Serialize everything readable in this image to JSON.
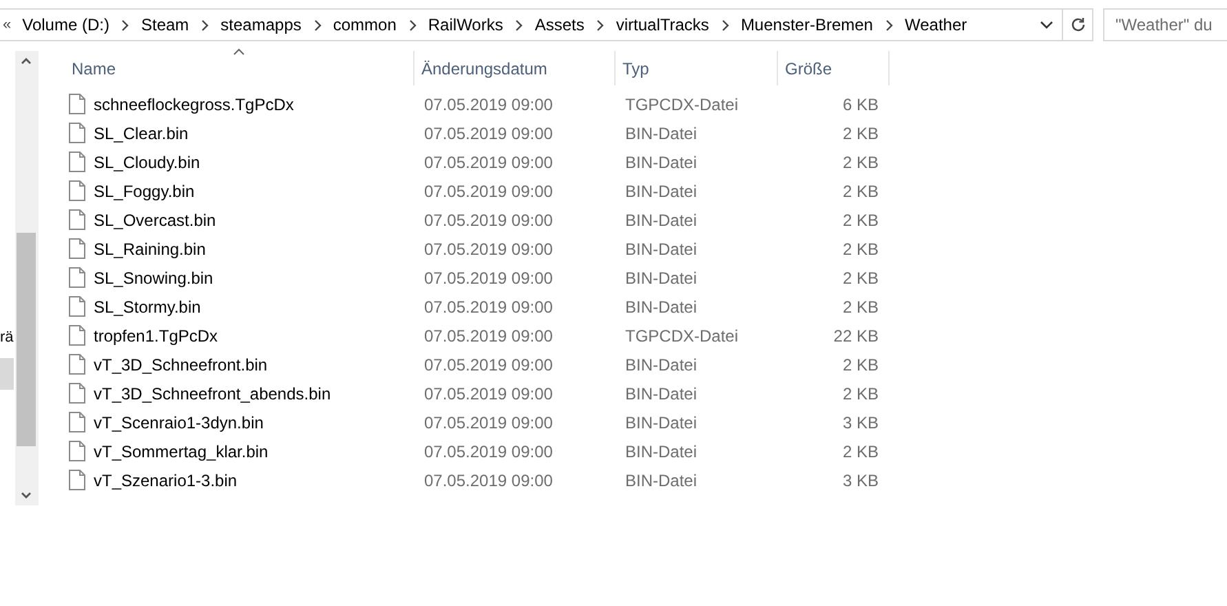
{
  "address_bar": {
    "overflow": "«",
    "path": [
      "Volume (D:)",
      "Steam",
      "steamapps",
      "common",
      "RailWorks",
      "Assets",
      "virtualTracks",
      "Muenster-Bremen",
      "Weather"
    ]
  },
  "search": {
    "placeholder": "\"Weather\" du"
  },
  "nav_pane": {
    "items": [
      {
        "label": "rä",
        "selected": false
      },
      {
        "selected": true
      }
    ]
  },
  "columns": [
    {
      "label": "Name",
      "sorted": true
    },
    {
      "label": "Änderungsdatum",
      "sorted": false
    },
    {
      "label": "Typ",
      "sorted": false
    },
    {
      "label": "Größe",
      "sorted": false
    }
  ],
  "files": [
    {
      "name": "schneeflockegross.TgPcDx",
      "date": "07.05.2019 09:00",
      "type": "TGPCDX-Datei",
      "size": "6 KB"
    },
    {
      "name": "SL_Clear.bin",
      "date": "07.05.2019 09:00",
      "type": "BIN-Datei",
      "size": "2 KB"
    },
    {
      "name": "SL_Cloudy.bin",
      "date": "07.05.2019 09:00",
      "type": "BIN-Datei",
      "size": "2 KB"
    },
    {
      "name": "SL_Foggy.bin",
      "date": "07.05.2019 09:00",
      "type": "BIN-Datei",
      "size": "2 KB"
    },
    {
      "name": "SL_Overcast.bin",
      "date": "07.05.2019 09:00",
      "type": "BIN-Datei",
      "size": "2 KB"
    },
    {
      "name": "SL_Raining.bin",
      "date": "07.05.2019 09:00",
      "type": "BIN-Datei",
      "size": "2 KB"
    },
    {
      "name": "SL_Snowing.bin",
      "date": "07.05.2019 09:00",
      "type": "BIN-Datei",
      "size": "2 KB"
    },
    {
      "name": "SL_Stormy.bin",
      "date": "07.05.2019 09:00",
      "type": "BIN-Datei",
      "size": "2 KB"
    },
    {
      "name": "tropfen1.TgPcDx",
      "date": "07.05.2019 09:00",
      "type": "TGPCDX-Datei",
      "size": "22 KB"
    },
    {
      "name": "vT_3D_Schneefront.bin",
      "date": "07.05.2019 09:00",
      "type": "BIN-Datei",
      "size": "2 KB"
    },
    {
      "name": "vT_3D_Schneefront_abends.bin",
      "date": "07.05.2019 09:00",
      "type": "BIN-Datei",
      "size": "2 KB"
    },
    {
      "name": "vT_Scenraio1-3dyn.bin",
      "date": "07.05.2019 09:00",
      "type": "BIN-Datei",
      "size": "3 KB"
    },
    {
      "name": "vT_Sommertag_klar.bin",
      "date": "07.05.2019 09:00",
      "type": "BIN-Datei",
      "size": "2 KB"
    },
    {
      "name": "vT_Szenario1-3.bin",
      "date": "07.05.2019 09:00",
      "type": "BIN-Datei",
      "size": "3 KB"
    }
  ]
}
